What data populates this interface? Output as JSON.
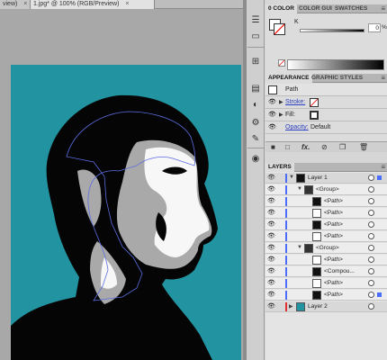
{
  "document": {
    "tabs": [
      {
        "label": "view)",
        "active": false
      },
      {
        "label": "1.jpg* @ 100% (RGB/Preview)",
        "active": true
      }
    ],
    "close_glyph": "×",
    "artboard_color": "#2294a1"
  },
  "tool_strip": {
    "icons": [
      "swatches-icon",
      "gradient-icon",
      "transform-icon",
      "align-icon",
      "transparency-icon",
      "symbols-icon",
      "brushes-icon",
      "graphic-styles-icon"
    ]
  },
  "color_panel": {
    "tabs": [
      "0 COLOR",
      "COLOR GUI",
      "SWATCHES"
    ],
    "channel_label": "K",
    "channel_value": "0",
    "channel_unit": "%",
    "menu_glyph": "≡"
  },
  "appearance_panel": {
    "tabs": [
      "APPEARANCE",
      "GRAPHIC STYLES"
    ],
    "object_label": "Path",
    "stroke_label": "Stroke:",
    "fill_label": "Fill:",
    "opacity_label": "Opacity:",
    "opacity_value": "Default",
    "footer_tool": "fx."
  },
  "layers_panel": {
    "tab_label": "LAYERS",
    "rows": [
      {
        "name": "Layer 1",
        "indent": 0,
        "kind": "layer",
        "color": "#4a6cff",
        "expanded": true
      },
      {
        "name": "<Group>",
        "indent": 1,
        "kind": "group",
        "color": "#4a6cff",
        "expanded": true
      },
      {
        "name": "<Path>",
        "indent": 2,
        "kind": "path",
        "color": "#4a6cff"
      },
      {
        "name": "<Path>",
        "indent": 2,
        "kind": "path",
        "color": "#4a6cff"
      },
      {
        "name": "<Path>",
        "indent": 2,
        "kind": "path",
        "color": "#4a6cff"
      },
      {
        "name": "<Path>",
        "indent": 2,
        "kind": "path",
        "color": "#4a6cff"
      },
      {
        "name": "<Group>",
        "indent": 1,
        "kind": "group",
        "color": "#4a6cff",
        "expanded": true
      },
      {
        "name": "<Path>",
        "indent": 2,
        "kind": "path",
        "color": "#4a6cff"
      },
      {
        "name": "<Compou...",
        "indent": 2,
        "kind": "path",
        "color": "#4a6cff"
      },
      {
        "name": "<Path>",
        "indent": 2,
        "kind": "path",
        "color": "#4a6cff"
      },
      {
        "name": "<Path>",
        "indent": 2,
        "kind": "path",
        "color": "#4a6cff",
        "selected": true
      },
      {
        "name": "Layer 2",
        "indent": 0,
        "kind": "layer",
        "color": "#e03030",
        "expanded": false
      }
    ]
  }
}
